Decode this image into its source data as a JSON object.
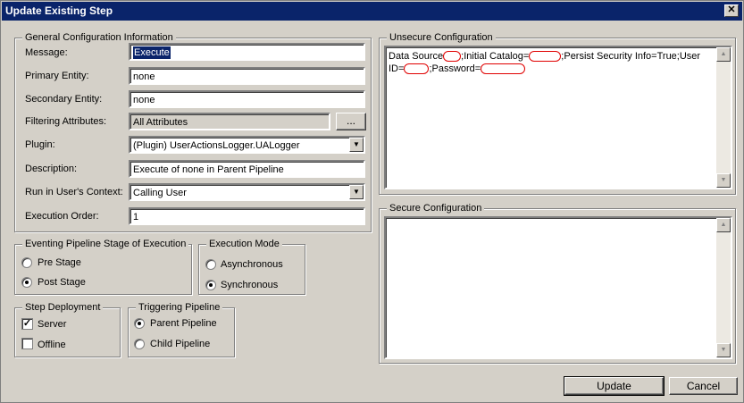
{
  "window": {
    "title": "Update Existing Step",
    "close_glyph": "✕"
  },
  "general": {
    "legend": "General Configuration Information",
    "message_label": "Message:",
    "message_value": "Execute",
    "primary_label": "Primary Entity:",
    "primary_value": "none",
    "secondary_label": "Secondary Entity:",
    "secondary_value": "none",
    "filtering_label": "Filtering Attributes:",
    "filtering_value": "All Attributes",
    "filtering_btn": "...",
    "plugin_label": "Plugin:",
    "plugin_value": "(Plugin) UserActionsLogger.UALogger",
    "description_label": "Description:",
    "description_value": "Execute of none in Parent Pipeline",
    "context_label": "Run in User's Context:",
    "context_value": "Calling User",
    "order_label": "Execution Order:",
    "order_value": "1"
  },
  "stage": {
    "legend": "Eventing Pipeline Stage of Execution",
    "pre": "Pre Stage",
    "post": "Post Stage",
    "selected": "post"
  },
  "mode": {
    "legend": "Execution Mode",
    "async": "Asynchronous",
    "sync": "Synchronous",
    "selected": "sync"
  },
  "deployment": {
    "legend": "Step Deployment",
    "server": "Server",
    "offline": "Offline",
    "server_checked": true,
    "offline_checked": false
  },
  "triggering": {
    "legend": "Triggering Pipeline",
    "parent": "Parent Pipeline",
    "child": "Child Pipeline",
    "selected": "parent"
  },
  "unsecure": {
    "legend": "Unsecure Configuration",
    "text_a": "Data Source",
    "text_b": ";Initial Catalog=",
    "text_c": ";Persist Security Info=True;User ID=",
    "text_d": ";Password="
  },
  "secure": {
    "legend": "Secure Configuration"
  },
  "buttons": {
    "update": "Update",
    "cancel": "Cancel"
  },
  "icons": {
    "up": "scroll-up-icon",
    "down": "scroll-down-icon",
    "dropdown": "chevron-down-icon"
  }
}
